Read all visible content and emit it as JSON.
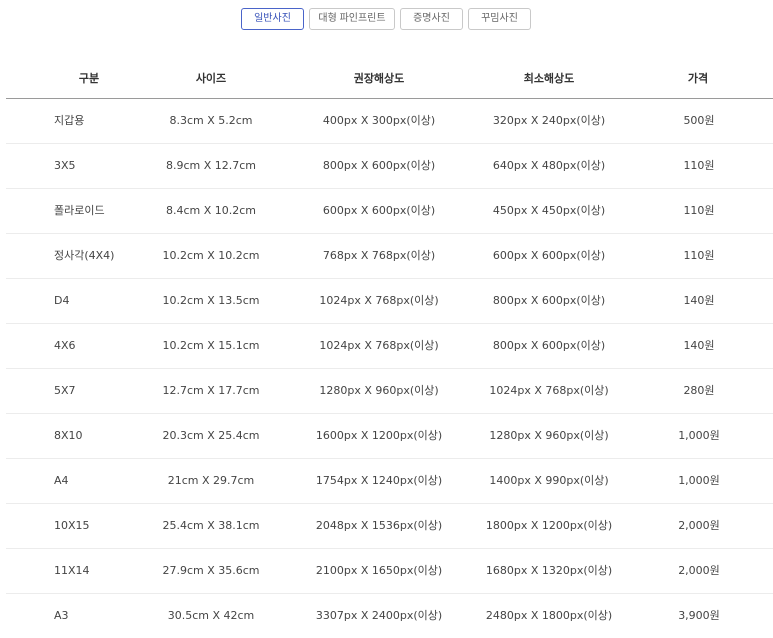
{
  "tabs": [
    {
      "label": "일반사진",
      "active": true
    },
    {
      "label": "대형 파인프린트",
      "active": false
    },
    {
      "label": "증명사진",
      "active": false
    },
    {
      "label": "꾸밈사진",
      "active": false
    }
  ],
  "table": {
    "headers": {
      "type": "구분",
      "size": "사이즈",
      "recommended": "권장해상도",
      "minimum": "최소해상도",
      "price": "가격"
    },
    "rows": [
      {
        "type": "지갑용",
        "size": "8.3cm X 5.2cm",
        "recommended": "400px X 300px(이상)",
        "minimum": "320px X 240px(이상)",
        "price": "500원"
      },
      {
        "type": "3X5",
        "size": "8.9cm X 12.7cm",
        "recommended": "800px X 600px(이상)",
        "minimum": "640px X 480px(이상)",
        "price": "110원"
      },
      {
        "type": "폴라로이드",
        "size": "8.4cm X 10.2cm",
        "recommended": "600px X 600px(이상)",
        "minimum": "450px X 450px(이상)",
        "price": "110원"
      },
      {
        "type": "정사각(4X4)",
        "size": "10.2cm X 10.2cm",
        "recommended": "768px X 768px(이상)",
        "minimum": "600px X 600px(이상)",
        "price": "110원"
      },
      {
        "type": "D4",
        "size": "10.2cm X 13.5cm",
        "recommended": "1024px X 768px(이상)",
        "minimum": "800px X 600px(이상)",
        "price": "140원"
      },
      {
        "type": "4X6",
        "size": "10.2cm X 15.1cm",
        "recommended": "1024px X 768px(이상)",
        "minimum": "800px X 600px(이상)",
        "price": "140원"
      },
      {
        "type": "5X7",
        "size": "12.7cm X 17.7cm",
        "recommended": "1280px X 960px(이상)",
        "minimum": "1024px X 768px(이상)",
        "price": "280원"
      },
      {
        "type": "8X10",
        "size": "20.3cm X 25.4cm",
        "recommended": "1600px X 1200px(이상)",
        "minimum": "1280px X 960px(이상)",
        "price": "1,000원"
      },
      {
        "type": "A4",
        "size": "21cm X 29.7cm",
        "recommended": "1754px X 1240px(이상)",
        "minimum": "1400px X 990px(이상)",
        "price": "1,000원"
      },
      {
        "type": "10X15",
        "size": "25.4cm X 38.1cm",
        "recommended": "2048px X 1536px(이상)",
        "minimum": "1800px X 1200px(이상)",
        "price": "2,000원"
      },
      {
        "type": "11X14",
        "size": "27.9cm X 35.6cm",
        "recommended": "2100px X 1650px(이상)",
        "minimum": "1680px X 1320px(이상)",
        "price": "2,000원"
      },
      {
        "type": "A3",
        "size": "30.5cm X 42cm",
        "recommended": "3307px X 2400px(이상)",
        "minimum": "2480px X 1800px(이상)",
        "price": "3,900원"
      }
    ]
  },
  "colors": {
    "active_tab": "#3550b8",
    "header_rule": "#9a9a9a",
    "row_rule": "#ececec"
  }
}
